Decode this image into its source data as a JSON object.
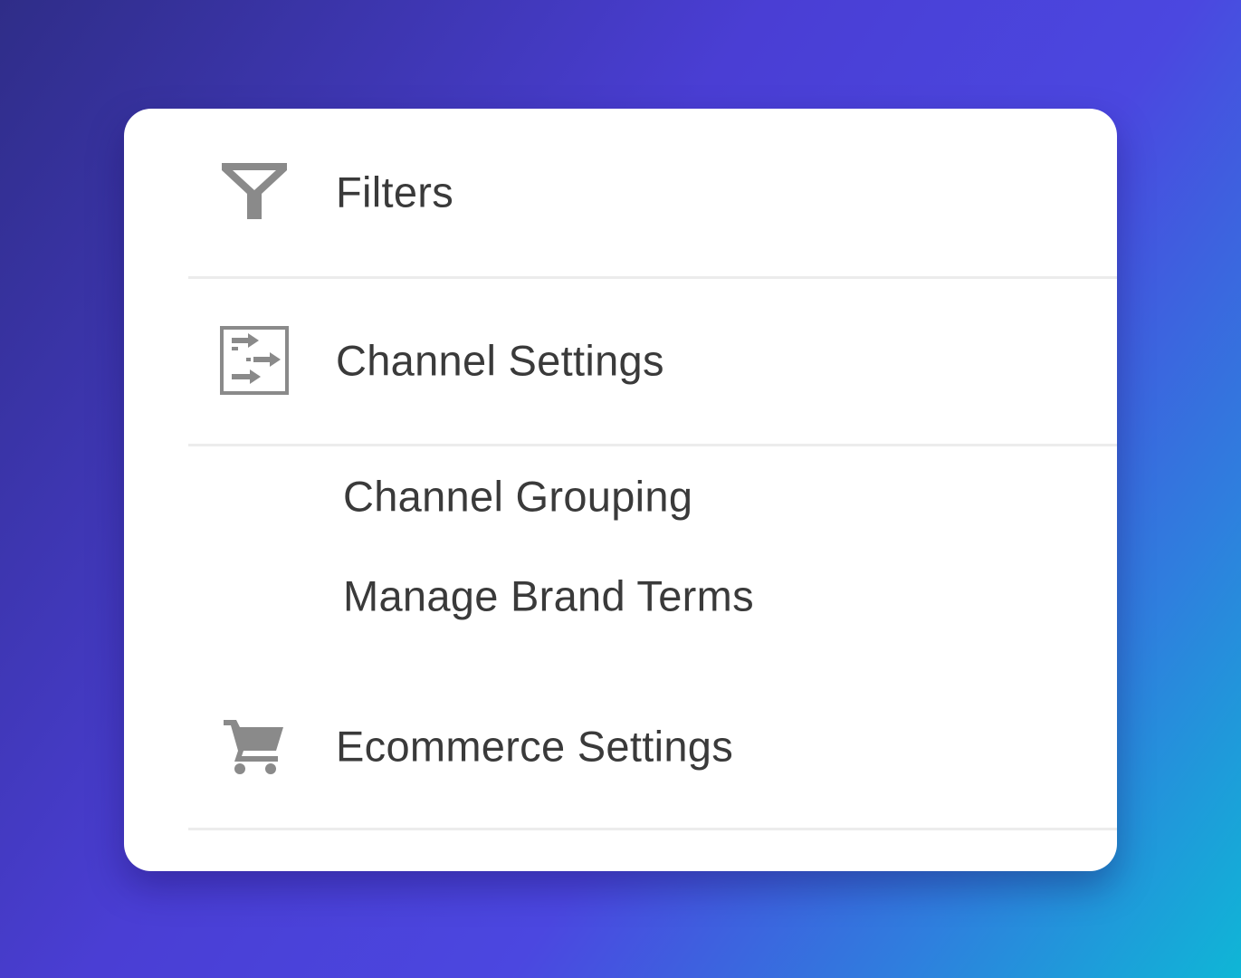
{
  "menu": {
    "items": [
      {
        "label": "Filters",
        "icon": "filter-icon"
      },
      {
        "label": "Channel Settings",
        "icon": "channel-settings-icon"
      },
      {
        "label": "Channel Grouping"
      },
      {
        "label": "Manage Brand Terms"
      },
      {
        "label": "Ecommerce Settings",
        "icon": "cart-icon"
      }
    ]
  },
  "colors": {
    "icon": "#8a8a8a",
    "text": "#3a3a3a",
    "panel": "#ffffff"
  }
}
